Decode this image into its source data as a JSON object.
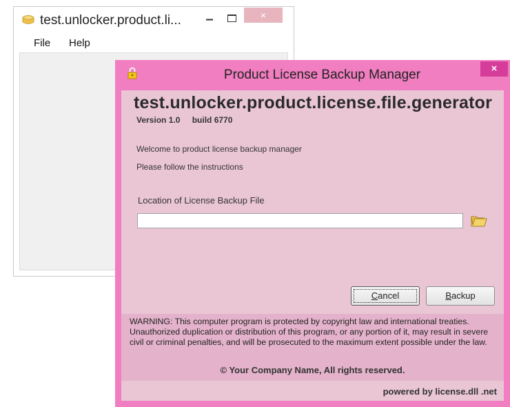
{
  "background_window": {
    "title": "test.unlocker.product.li...",
    "min_label": "–",
    "close_label": "×",
    "menu": [
      {
        "label": "File"
      },
      {
        "label": "Help"
      }
    ]
  },
  "dialog": {
    "title": "Product License Backup Manager",
    "close_label": "×",
    "product_name": "test.unlocker.product.license.file.generator",
    "version": "Version 1.0",
    "build": "build 6770",
    "welcome": "Welcome to product license backup manager",
    "instructions": "Please follow the instructions",
    "location_label": "Location of License Backup File",
    "location_value": "",
    "cancel_accel": "C",
    "cancel_rest": "ancel",
    "backup_accel": "B",
    "backup_rest": "ackup",
    "warning": "WARNING: This computer program is protected by copyright law and international treaties. Unauthorized duplication or distribution of this program, or any portion of it, may result in severe civil or criminal penalties, and will be prosecuted to the maximum extent possible under the law.",
    "copyright": "© Your Company Name, All rights reserved.",
    "powered_by": "powered by license.dll .net"
  },
  "colors": {
    "dialog_frame": "#f07ec0",
    "dialog_client": "#eac6d5",
    "warning_bg": "#e4b3cb",
    "close_button": "#d63c9a"
  },
  "icons": {
    "bg_window_icon": "app-box-icon",
    "dialog_icon": "padlock-icon",
    "browse_icon": "folder-icon"
  }
}
